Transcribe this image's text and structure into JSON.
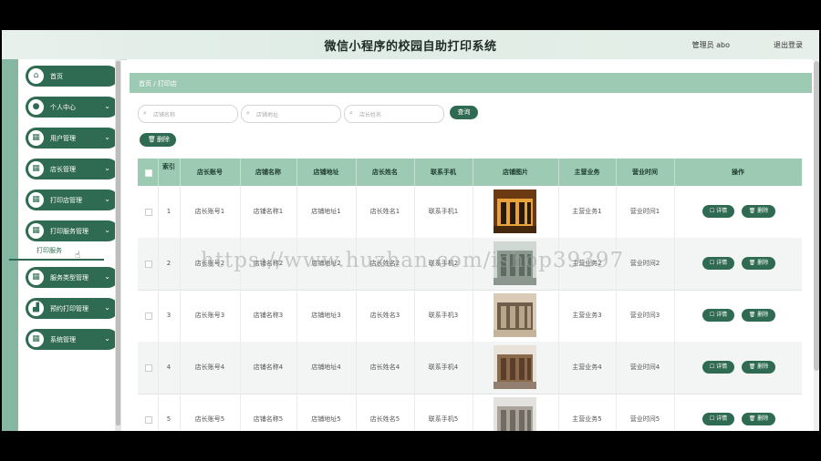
{
  "header": {
    "title": "微信小程序的校园自助打印系统",
    "user": "管理员 abo",
    "logout": "退出登录"
  },
  "sidebar": {
    "items": [
      {
        "label": "首页",
        "icon": "home-icon",
        "chevron": ""
      },
      {
        "label": "个人中心",
        "icon": "person-icon",
        "chevron": "⌄"
      },
      {
        "label": "用户管理",
        "icon": "grid-icon",
        "chevron": "⌄"
      },
      {
        "label": "店长管理",
        "icon": "grid-icon",
        "chevron": "⌄"
      },
      {
        "label": "打印店管理",
        "icon": "grid-icon",
        "chevron": "⌄"
      },
      {
        "label": "打印服务管理",
        "icon": "grid-icon",
        "chevron": "⌄"
      },
      {
        "label": "服务类型管理",
        "icon": "grid-icon",
        "chevron": "⌄"
      },
      {
        "label": "预约打印管理",
        "icon": "chart-icon",
        "chevron": "⌄"
      },
      {
        "label": "系统管理",
        "icon": "grid-icon",
        "chevron": "⌄"
      }
    ],
    "submenu": "打印服务"
  },
  "breadcrumb": {
    "home": "首页",
    "sep": "/",
    "current": "打印店"
  },
  "search": {
    "placeholders": [
      "店铺名称",
      "店铺地址",
      "店长姓名"
    ],
    "button": "查询"
  },
  "toolbar": {
    "delete_label": "删除",
    "delete_icon": "🗑"
  },
  "table": {
    "headers": [
      "索引",
      "店长账号",
      "店铺名称",
      "店铺地址",
      "店长姓名",
      "联系手机",
      "店铺图片",
      "主营业务",
      "营业时间",
      "操作"
    ],
    "rows": [
      [
        "1",
        "店长账号1",
        "店铺名称1",
        "店铺地址1",
        "店长姓名1",
        "联系手机1",
        "主营业务1",
        "营业时间1"
      ],
      [
        "2",
        "店长账号2",
        "店铺名称2",
        "店铺地址2",
        "店长姓名2",
        "联系手机2",
        "主营业务2",
        "营业时间2"
      ],
      [
        "3",
        "店长账号3",
        "店铺名称3",
        "店铺地址3",
        "店长姓名3",
        "联系手机3",
        "主营业务3",
        "营业时间3"
      ],
      [
        "4",
        "店长账号4",
        "店铺名称4",
        "店铺地址4",
        "店长姓名4",
        "联系手机4",
        "主营业务4",
        "营业时间4"
      ],
      [
        "5",
        "店长账号5",
        "店铺名称5",
        "店铺地址5",
        "店长姓名5",
        "联系手机5",
        "主营业务5",
        "营业时间5"
      ]
    ],
    "detail_label": "详情",
    "delete_label": "删除"
  },
  "watermark": "https://www.huzhan.com/ishop39397",
  "colors": {
    "primary": "#2f6b52",
    "header_bg": "#9ccab3",
    "side_bg": "#86b7a2"
  }
}
